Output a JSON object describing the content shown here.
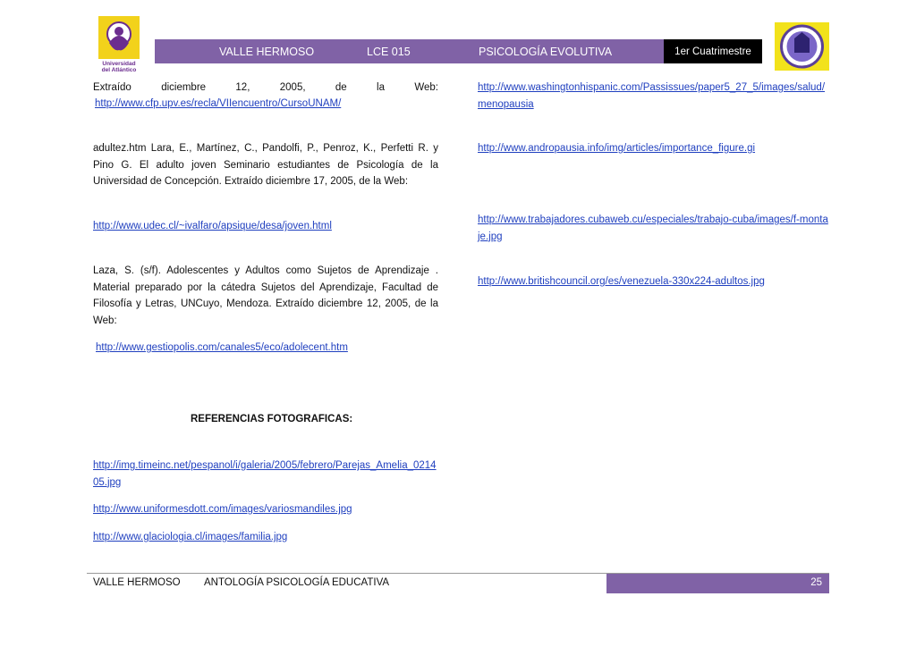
{
  "header": {
    "campus": "VALLE HERMOSO",
    "code": "LCE 015",
    "subject": "PSICOLOGÍA EVOLUTIVA",
    "term": "1er Cuatrimestre"
  },
  "logos": {
    "left_caption_1": "Universidad",
    "left_caption_2": "del Atlántico"
  },
  "left_column": {
    "p1_line1": "Extraído diciembre 12, 2005, de la Web:",
    "p1_link": "http://www.cfp.upv.es/recla/VIIencuentro/CursoUNAM/",
    "p2_text": "adultez.htm Lara, E., Martínez, C., Pandolfi, P., Penroz, K., Perfetti R. y Pino G. El adulto joven Seminario estudiantes de Psicología de la Universidad de Concepción. Extraído diciembre 17, 2005, de la Web:",
    "p2_link": "http://www.udec.cl/~ivalfaro/apsique/desa/joven.html",
    "p3_text": "Laza, S. (s/f). Adolescentes y Adultos como Sujetos de Aprendizaje . Material preparado por la cátedra Sujetos del Aprendizaje, Facultad de Filosofía y Letras, UNCuyo, Mendoza. Extraído diciembre 12, 2005, de la Web:",
    "p3_link": "http://www.gestiopolis.com/canales5/eco/adolecent.htm",
    "refs_title": "REFERENCIAS FOTOGRAFICAS:",
    "photo_link_1": "http://img.timeinc.net/pespanol/i/galeria/2005/febrero/Parejas_Amelia_021405.jpg",
    "photo_link_2": "http://www.uniformesdott.com/images/variosmandiles.jpg",
    "photo_link_3": "http://www.glaciologia.cl/images/familia.jpg"
  },
  "right_column": {
    "link_1": "http://www.washingtonhispanic.com/Passissues/paper5_27_5/images/salud/menopausia",
    "link_2": "http://www.andropausia.info/img/articles/importance_figure.gi",
    "link_3": "http://www.trabajadores.cubaweb.cu/especiales/trabajo-cuba/images/f-montaje.jpg",
    "link_4": "http://www.britishcouncil.org/es/venezuela-330x224-adultos.jpg"
  },
  "footer": {
    "campus": "VALLE HERMOSO",
    "title": "ANTOLOGÍA PSICOLOGÍA EDUCATIVA",
    "page_number": "25"
  },
  "colors": {
    "accent_purple": "#8062a6",
    "link_blue": "#1f3fbf"
  }
}
